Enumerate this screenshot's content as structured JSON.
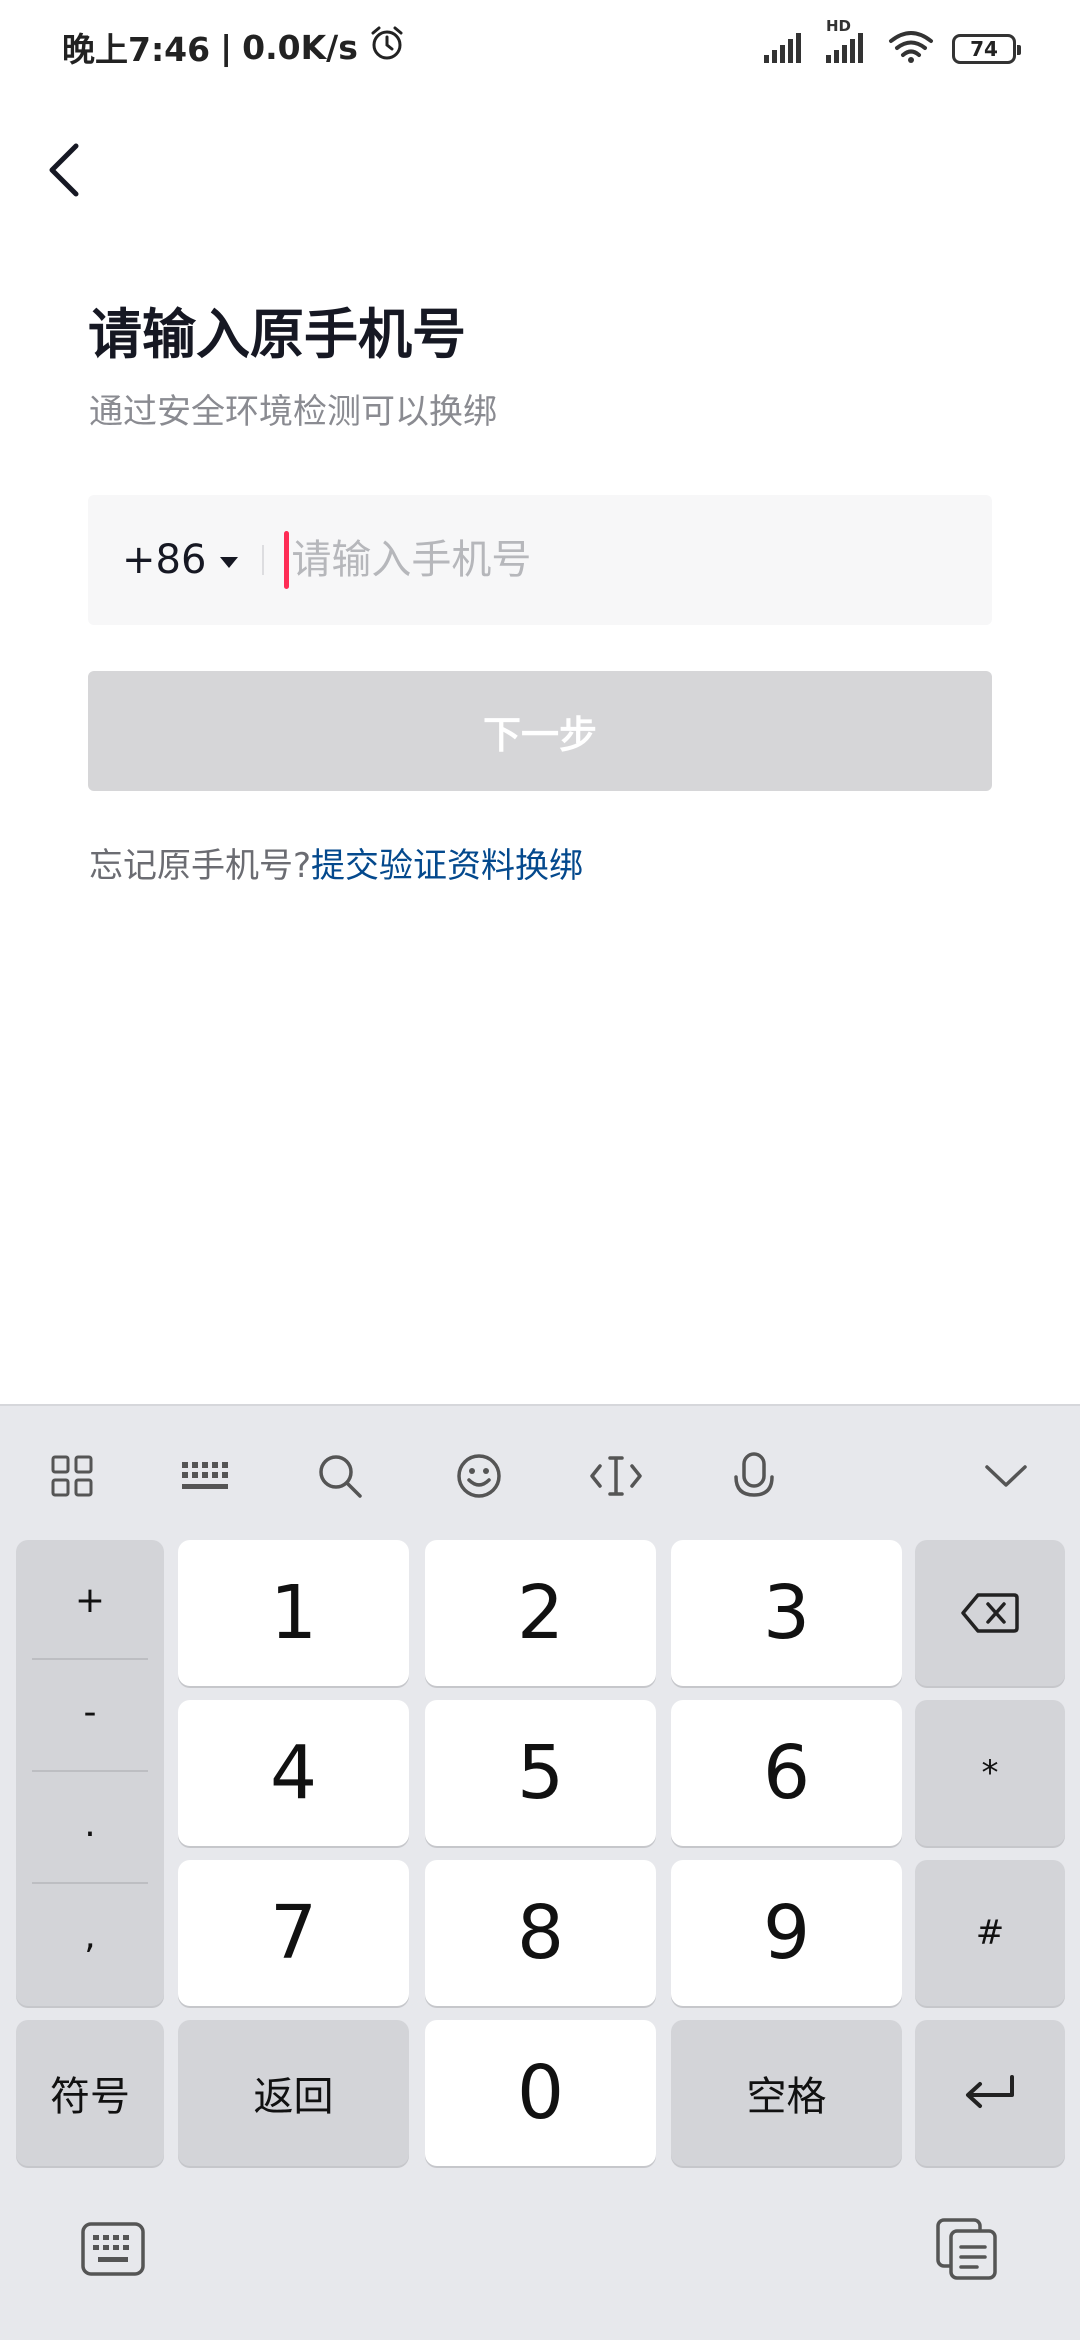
{
  "status_bar": {
    "time": "晚上7:46",
    "separator": "|",
    "speed": "0.0K/s",
    "battery": "74",
    "hd_label": "HD"
  },
  "page": {
    "title": "请输入原手机号",
    "subtitle": "通过安全环境检测可以换绑"
  },
  "phone_form": {
    "country_code": "+86",
    "placeholder": "请输入手机号",
    "value": "",
    "next_label": "下一步"
  },
  "help": {
    "text": "忘记原手机号?",
    "link": "提交验证资料换绑"
  },
  "keyboard": {
    "side_keys": [
      "+",
      "-",
      ".",
      ","
    ],
    "digits": [
      "1",
      "2",
      "3",
      "4",
      "5",
      "6",
      "7",
      "8",
      "9",
      "0"
    ],
    "right_keys": [
      "*",
      "#"
    ],
    "symbols_label": "符号",
    "back_label": "返回",
    "space_label": "空格",
    "icons": {
      "apps": "grid-icon",
      "layout": "keyboard-layout-icon",
      "search": "search-icon",
      "emoji": "emoji-icon",
      "cursor": "cursor-move-icon",
      "voice": "microphone-icon",
      "collapse": "chevron-down-icon",
      "delete": "backspace-icon",
      "enter": "enter-icon",
      "switch": "keyboard-switch-icon",
      "clipboard": "clipboard-icon"
    }
  },
  "colors": {
    "accent_cursor": "#fe2c55",
    "link": "#04498d",
    "button_disabled": "#d6d6d8",
    "keyboard_bg": "#e7e8ec"
  }
}
